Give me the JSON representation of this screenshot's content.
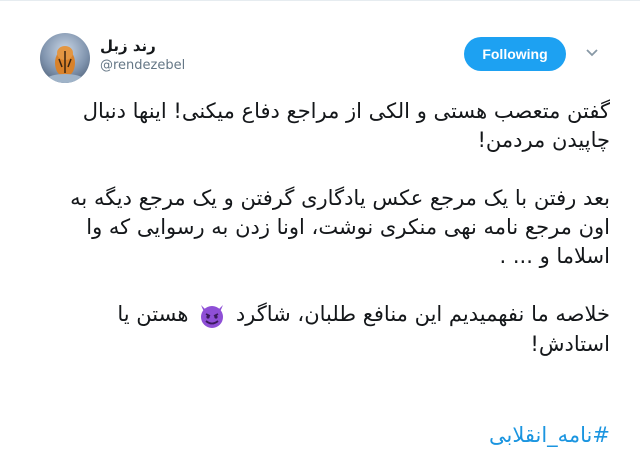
{
  "author": {
    "display_name": "رند زبل",
    "handle": "@rendezebel"
  },
  "follow_button": {
    "label": "Following"
  },
  "menu": {
    "icon": "chevron-down-icon"
  },
  "tweet": {
    "paragraphs": [
      "گفتن متعصب هستی و الکی از مراجع دفاع میکنی! اینها دنبال چاپیدن مردمن!",
      "بعد رفتن با یک مرجع عکس یادگاری گرفتن و یک مرجع دیگه به اون مرجع نامه نهی منکری نوشت، اونا زدن به رسوایی که وا اسلاما و ... .",
      "خلاصه ما نفهمیدیم این منافع طلبان، شاگرد",
      "هستن یا استادش!"
    ],
    "emoji": "smiling-imp-emoji",
    "hashtag": "#نامه_انقلابی"
  },
  "colors": {
    "accent": "#1da1f2",
    "hashtag": "#1b95e0",
    "emoji": "#8e4fd6"
  }
}
